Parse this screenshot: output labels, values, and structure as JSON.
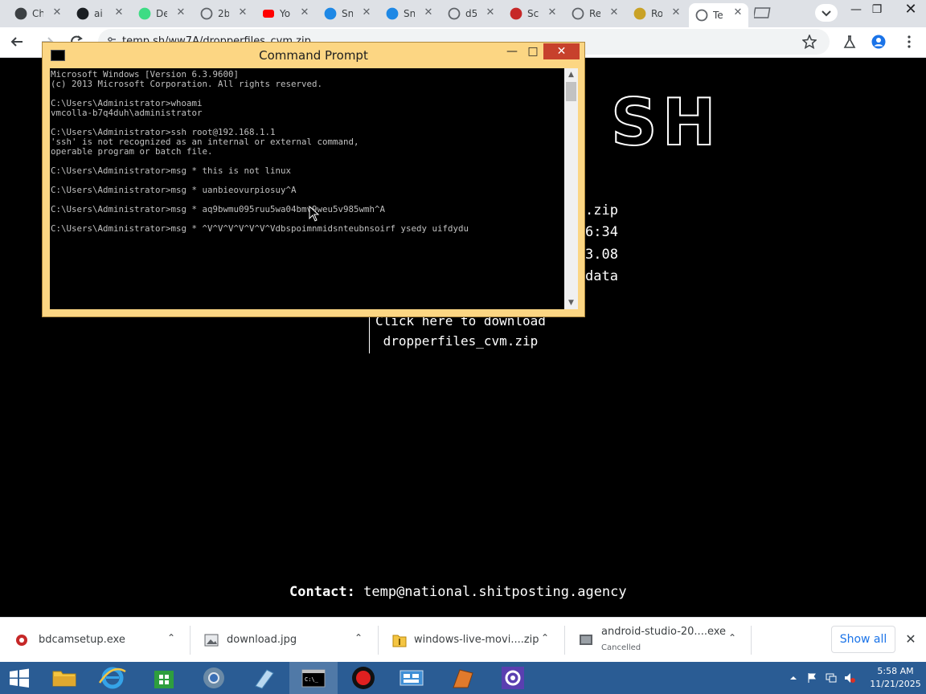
{
  "browser": {
    "tabs": [
      {
        "label": "Ch",
        "icon": "chatgpt-icon"
      },
      {
        "label": "ai",
        "icon": "github-icon"
      },
      {
        "label": "De",
        "icon": "android-icon"
      },
      {
        "label": "2b",
        "icon": "globe-icon"
      },
      {
        "label": "Yo",
        "icon": "youtube-icon"
      },
      {
        "label": "Sn",
        "icon": "snake-icon"
      },
      {
        "label": "Sn",
        "icon": "snake-icon"
      },
      {
        "label": "d5",
        "icon": "globe-icon"
      },
      {
        "label": "Sc",
        "icon": "record-icon"
      },
      {
        "label": "Re",
        "icon": "globe-icon"
      },
      {
        "label": "Ro",
        "icon": "coin-icon"
      },
      {
        "label": "Te",
        "icon": "globe-icon"
      }
    ],
    "url": "temp.sh/ww7A/dropperfiles_cvm.zip"
  },
  "page": {
    "logo_text": "SH",
    "info_lines": [
      ".zip",
      "6:34",
      "3.08",
      "data"
    ],
    "download_line1": "Click here to download",
    "download_line2": " dropperfiles_cvm.zip",
    "contact_label": "Contact:",
    "contact_value": " temp@national.shitposting.agency"
  },
  "cmd": {
    "title": "Command Prompt",
    "console_text": "Microsoft Windows [Version 6.3.9600]\n(c) 2013 Microsoft Corporation. All rights reserved.\n\nC:\\Users\\Administrator>whoami\nvmcolla-b7q4duh\\administrator\n\nC:\\Users\\Administrator>ssh root@192.168.1.1\n'ssh' is not recognized as an internal or external command,\noperable program or batch file.\n\nC:\\Users\\Administrator>msg * this is not linux\n\nC:\\Users\\Administrator>msg * uanbieovurpiosuy^A\n\nC:\\Users\\Administrator>msg * aq9bwmu095ruu5wa04bmv9weu5v985wmh^A\n\nC:\\Users\\Administrator>msg * ^V^V^V^V^V^V^Vdbspoimnmidsnteubnsoirf ysedy uifdydu"
  },
  "downloads": [
    {
      "name": "bdcamsetup.exe",
      "status": ""
    },
    {
      "name": "download.jpg",
      "status": ""
    },
    {
      "name": "windows-live-movi....zip",
      "status": ""
    },
    {
      "name": "android-studio-20....exe",
      "status": "Cancelled"
    }
  ],
  "downloads_show_all": "Show all",
  "taskbar": {
    "time": "5:58 AM",
    "date": "11/21/2025",
    "accent": "#2a5c94"
  }
}
